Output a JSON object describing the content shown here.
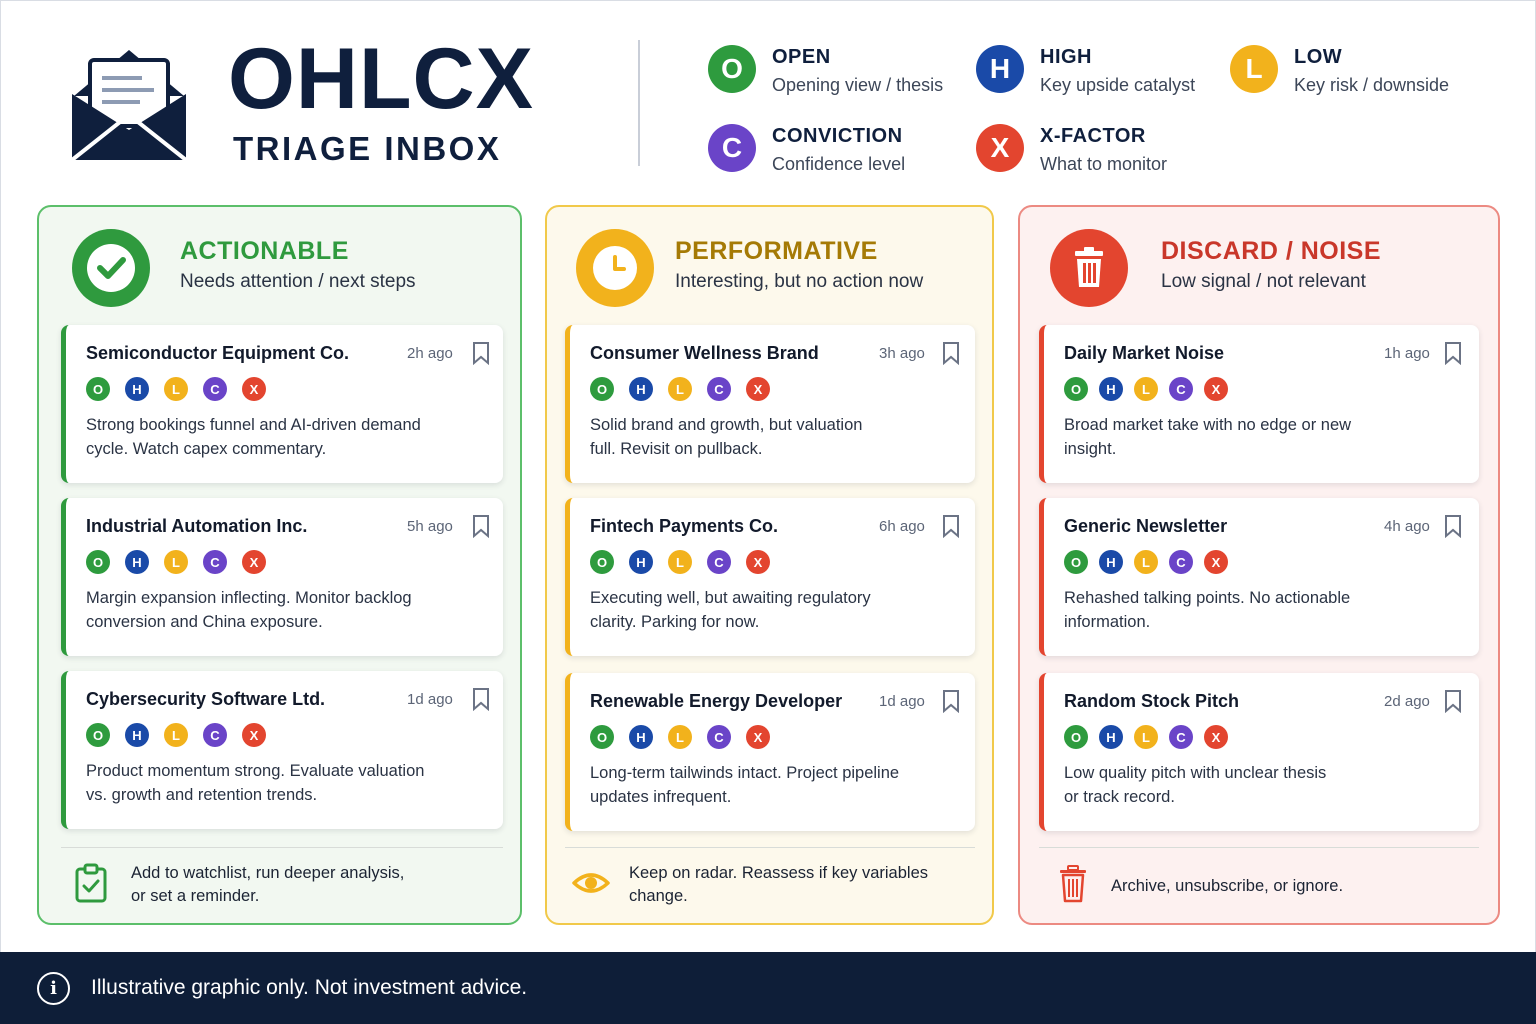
{
  "header": {
    "title": "OHLCX",
    "subtitle": "TRIAGE INBOX",
    "icon": "open-envelope-icon"
  },
  "legend": [
    {
      "letter": "O",
      "title": "OPEN",
      "desc": "Opening view / thesis",
      "color": "#2e9b3e"
    },
    {
      "letter": "H",
      "title": "HIGH",
      "desc": "Key upside catalyst",
      "color": "#1a4aa8"
    },
    {
      "letter": "L",
      "title": "LOW",
      "desc": "Key risk / downside",
      "color": "#f2b21c"
    },
    {
      "letter": "C",
      "title": "CONVICTION",
      "desc": "Confidence level",
      "color": "#6a44c8"
    },
    {
      "letter": "X",
      "title": "X-FACTOR",
      "desc": "What to monitor",
      "color": "#e3452f"
    }
  ],
  "badge_letters": [
    "O",
    "H",
    "L",
    "C",
    "X"
  ],
  "columns": [
    {
      "key": "actionable",
      "title": "ACTIONABLE",
      "desc": "Needs attention / next steps",
      "accent": "#2f9a3e",
      "icon": "check-circle-icon",
      "cards": [
        {
          "title": "Semiconductor Equipment Co.",
          "time": "2h ago",
          "line1": "Strong bookings funnel and AI-driven demand",
          "line2": "cycle. Watch capex commentary."
        },
        {
          "title": "Industrial Automation Inc.",
          "time": "5h ago",
          "line1": "Margin expansion inflecting. Monitor backlog",
          "line2": "conversion and China exposure."
        },
        {
          "title": "Cybersecurity Software Ltd.",
          "time": "1d ago",
          "line1": "Product momentum strong. Evaluate valuation",
          "line2": "vs. growth and retention trends."
        }
      ],
      "footer_icon": "clipboard-check-icon",
      "footer_line1": "Add to watchlist, run deeper analysis,",
      "footer_line2": "or set a reminder."
    },
    {
      "key": "performative",
      "title": "PERFORMATIVE",
      "desc": "Interesting, but no action now",
      "accent": "#a57a05",
      "icon": "clock-icon",
      "cards": [
        {
          "title": "Consumer Wellness Brand",
          "time": "3h ago",
          "line1": "Solid brand and growth, but valuation",
          "line2": "full. Revisit on pullback."
        },
        {
          "title": "Fintech Payments Co.",
          "time": "6h ago",
          "line1": "Executing well, but awaiting regulatory",
          "line2": "clarity. Parking for now."
        },
        {
          "title": "Renewable Energy Developer",
          "time": "1d ago",
          "line1": "Long-term tailwinds intact. Project pipeline",
          "line2": "updates infrequent."
        }
      ],
      "footer_icon": "eye-icon",
      "footer_line1": "Keep on radar. Reassess if key variables",
      "footer_line2": "change."
    },
    {
      "key": "discard",
      "title": "DISCARD / NOISE",
      "desc": "Low signal / not relevant",
      "accent": "#c9372a",
      "icon": "trash-icon",
      "cards": [
        {
          "title": "Daily Market Noise",
          "time": "1h ago",
          "line1": "Broad market take with no edge or new",
          "line2": "insight."
        },
        {
          "title": "Generic Newsletter",
          "time": "4h ago",
          "line1": "Rehashed talking points. No actionable",
          "line2": "information."
        },
        {
          "title": "Random Stock Pitch",
          "time": "2d ago",
          "line1": "Low quality pitch with unclear thesis",
          "line2": "or track record."
        }
      ],
      "footer_icon": "trash-icon",
      "footer_line1": "Archive, unsubscribe, or ignore.",
      "footer_line2": ""
    }
  ],
  "footer": {
    "text": "Illustrative graphic only. Not investment advice.",
    "icon": "info-icon"
  }
}
